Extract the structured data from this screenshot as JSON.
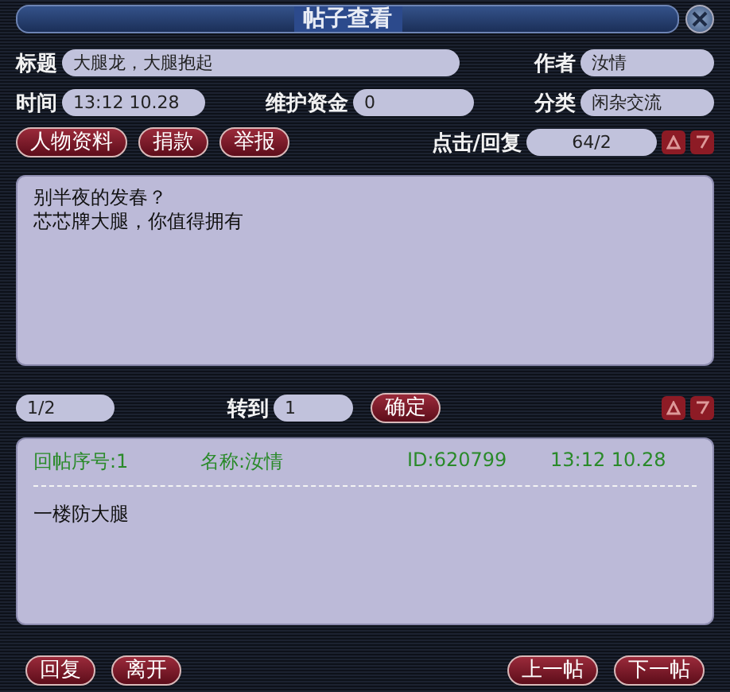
{
  "window": {
    "title": "帖子查看"
  },
  "fields": [
    {
      "label": "标题",
      "value": "大腿龙，大腿抱起"
    },
    {
      "label": "作者",
      "value": "汝情"
    },
    {
      "label": "时间",
      "value": "13:12 10.28"
    },
    {
      "label": "维护资金",
      "value": "0"
    },
    {
      "label": "分类",
      "value": "闲杂交流"
    }
  ],
  "actions": [
    "人物资料",
    "捐款",
    "举报"
  ],
  "clicks": {
    "label": "点击/回复",
    "value": "64/2"
  },
  "post_body": [
    "别半夜的发春？",
    "芯芯牌大腿，你值得拥有"
  ],
  "pager": {
    "page": "1/2",
    "goto_label": "转到",
    "goto_value": "1",
    "confirm": "确定"
  },
  "reply": {
    "number": "回帖序号:1",
    "name": "名称:汝情",
    "id": "ID:620799",
    "time": "13:12 10.28",
    "body": "一楼防大腿"
  },
  "bottom_left_buttons": [
    "回复",
    "离开"
  ],
  "bottom_right_buttons": [
    "上一帖",
    "下一帖"
  ]
}
